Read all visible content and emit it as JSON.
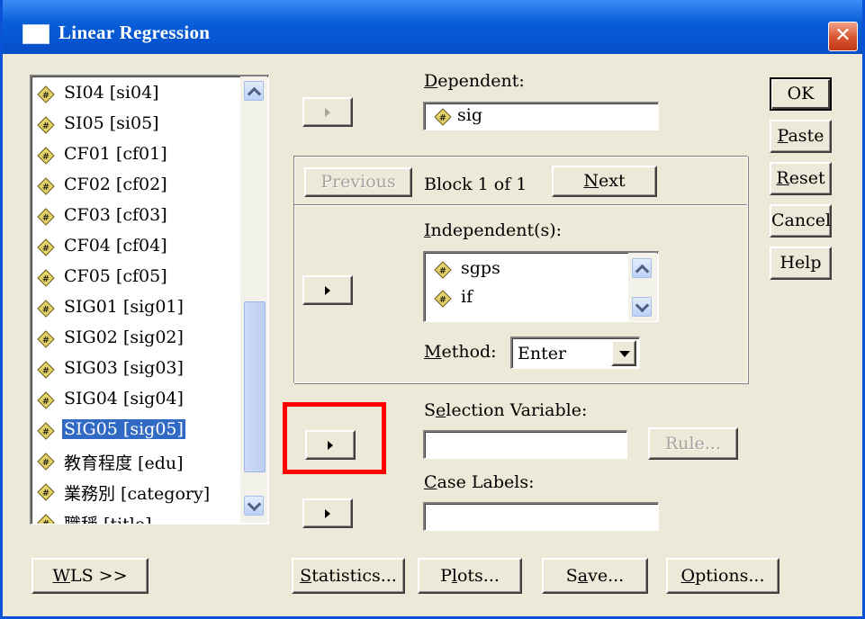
{
  "window": {
    "title": "Linear Regression",
    "close_glyph": "✕"
  },
  "variables": [
    "SI04 [si04]",
    "SI05 [si05]",
    "CF01 [cf01]",
    "CF02 [cf02]",
    "CF03 [cf03]",
    "CF04 [cf04]",
    "CF05 [cf05]",
    "SIG01 [sig01]",
    "SIG02 [sig02]",
    "SIG03 [sig03]",
    "SIG04 [sig04]",
    "SIG05 [sig05]",
    "教育程度 [edu]",
    "業務別 [category]",
    "職稱 [title]"
  ],
  "selected_variable": "SIG05 [sig05]",
  "dependent": {
    "label_pre": "",
    "label_u": "D",
    "label_post": "ependent:",
    "value": "sig"
  },
  "block": {
    "previous_label": "Previous",
    "status": "Block 1 of 1",
    "next_u": "N",
    "next_post": "ext"
  },
  "independents": {
    "label_u": "I",
    "label_post": "ndependent(s):",
    "items": [
      "sgps",
      "if"
    ]
  },
  "method": {
    "label_u": "M",
    "label_post": "ethod:",
    "value": "Enter"
  },
  "selection_variable": {
    "label_pre": "S",
    "label_u": "e",
    "label_post": "lection Variable:",
    "value": "",
    "rule_label": "Rule..."
  },
  "case_labels": {
    "label_u": "C",
    "label_post": "ase Labels:",
    "value": ""
  },
  "side_buttons": {
    "ok": "OK",
    "paste_u": "P",
    "paste_post": "aste",
    "reset_u": "R",
    "reset_post": "eset",
    "cancel": "Cancel",
    "help": "Help"
  },
  "bottom_buttons": {
    "wls_u": "W",
    "wls_post": "LS >>",
    "statistics_u": "S",
    "statistics_post": "tatistics...",
    "plots_pre": "P",
    "plots_u": "l",
    "plots_post": "ots...",
    "save_pre": "S",
    "save_u": "a",
    "save_post": "ve...",
    "options_u": "O",
    "options_post": "ptions..."
  },
  "highlight": {
    "color": "#ff0000",
    "target": "selection-variable-arrow-button"
  },
  "colors": {
    "title_bar": "#0a5fd8",
    "selection": "#316ac5",
    "dialog_face": "#ece9d8"
  },
  "icons": {
    "variable": "scale-variable-icon"
  }
}
